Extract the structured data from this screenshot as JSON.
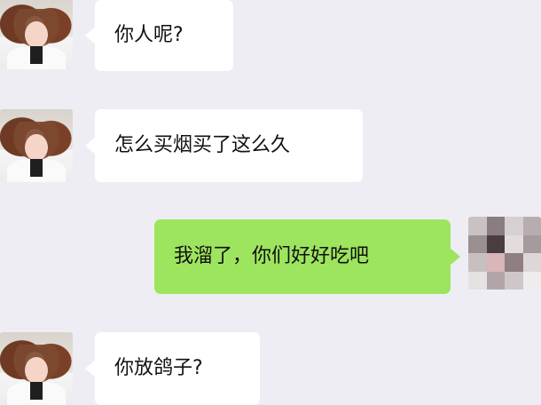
{
  "messages": [
    {
      "side": "left",
      "text": "你人呢?"
    },
    {
      "side": "left",
      "text": "怎么买烟买了这么久"
    },
    {
      "side": "right",
      "text": "我溜了，你们好好吃吧"
    },
    {
      "side": "left",
      "text": "你放鸽子?"
    }
  ],
  "colors": {
    "background": "#eeedf3",
    "incoming_bubble": "#ffffff",
    "outgoing_bubble": "#9de45f"
  },
  "icons": {
    "contact_avatar": "girl-photo-avatar-icon",
    "own_avatar": "pixelated-avatar-icon"
  }
}
